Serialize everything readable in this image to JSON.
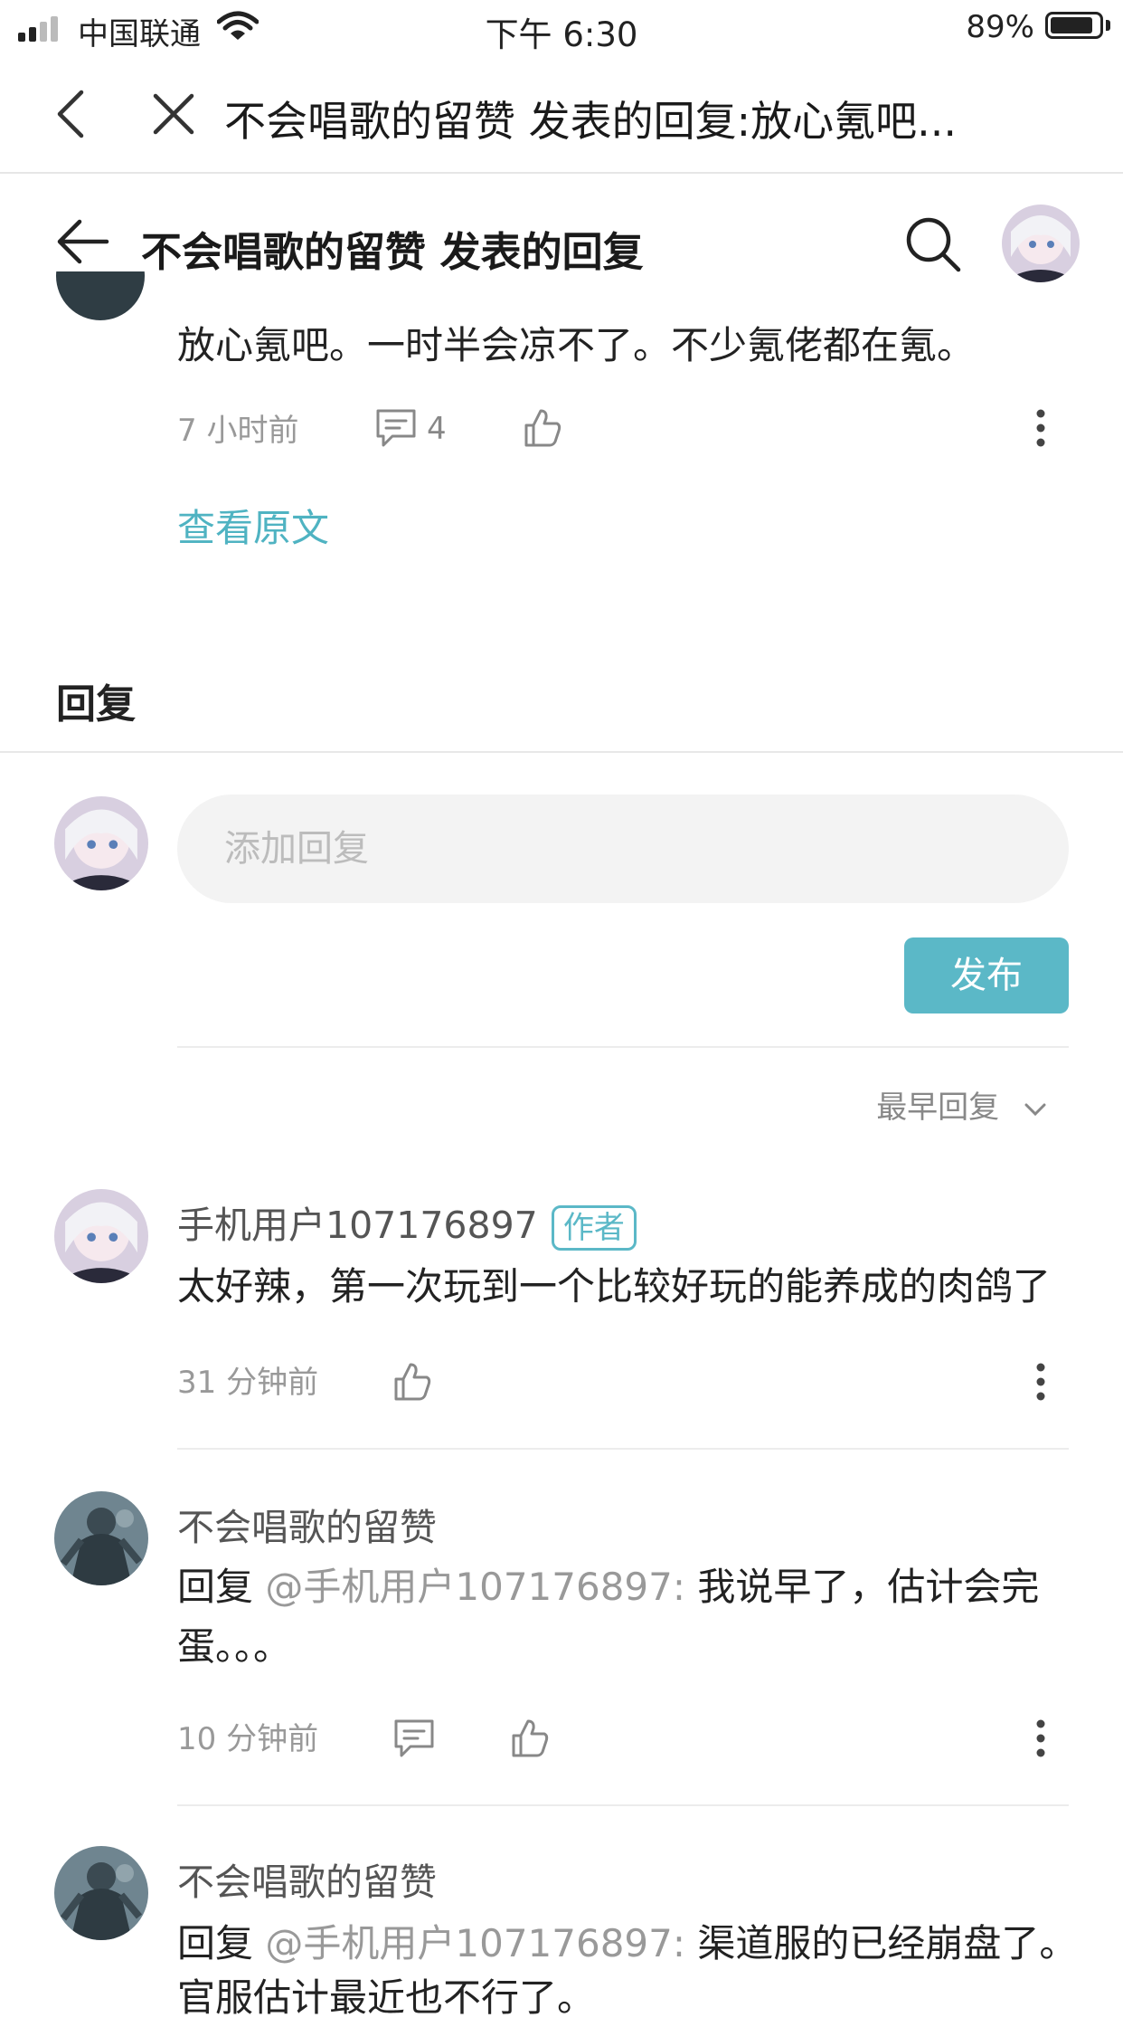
{
  "status_bar": {
    "carrier": "中国联通",
    "time": "下午 6:30",
    "battery": "89%",
    "battery_level": 0.89
  },
  "browser_bar": {
    "title": "不会唱歌的留赞 发表的回复:放心氪吧..."
  },
  "header": {
    "title": "不会唱歌的留赞 发表的回复"
  },
  "original": {
    "text": "放心氪吧。一时半会凉不了。不少氪佬都在氪。",
    "time": "7 小时前",
    "comment_count": "4",
    "view_original": "查看原文"
  },
  "replies_section": {
    "title": "回复",
    "input_placeholder": "添加回复",
    "publish_label": "发布",
    "sort_label": "最早回复"
  },
  "replies": [
    {
      "author": "手机用户107176897",
      "badge": "作者",
      "text": "太好辣，第一次玩到一个比较好玩的能养成的肉鸽了",
      "time": "31 分钟前"
    },
    {
      "author": "不会唱歌的留赞",
      "prefix": "回复",
      "mention": "@手机用户107176897:",
      "line1": "我说早了，估计会完",
      "line2": "蛋。。。",
      "time": "10 分钟前"
    },
    {
      "author": "不会唱歌的留赞",
      "prefix": "回复",
      "mention": "@手机用户107176897:",
      "line1": "渠道服的已经崩盘了。",
      "line2": "官服估计最近也不行了。"
    }
  ]
}
